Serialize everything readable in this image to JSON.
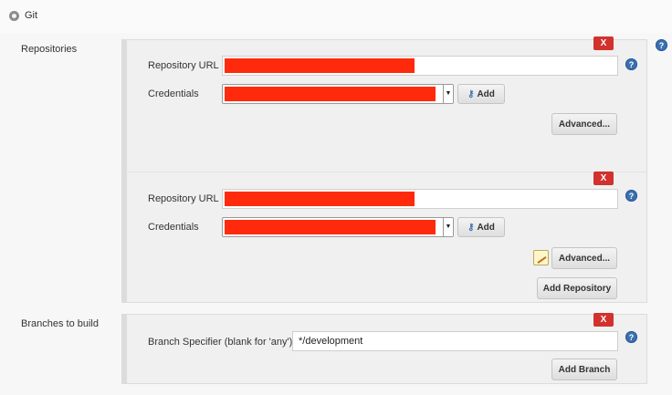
{
  "header": {
    "title": "Git"
  },
  "repositories": {
    "label": "Repositories",
    "items": [
      {
        "url_label": "Repository URL",
        "url_value": "",
        "credentials_label": "Credentials",
        "credentials_value": "",
        "add_label": "Add",
        "advanced_label": "Advanced...",
        "delete_label": "X"
      },
      {
        "url_label": "Repository URL",
        "url_value": "",
        "credentials_label": "Credentials",
        "credentials_value": "",
        "add_label": "Add",
        "advanced_label": "Advanced...",
        "delete_label": "X"
      }
    ],
    "add_repository_label": "Add Repository"
  },
  "branches": {
    "label": "Branches to build",
    "specifier_label": "Branch Specifier (blank for 'any')",
    "specifier_value": "*/development",
    "delete_label": "X",
    "add_branch_label": "Add Branch"
  },
  "help": {
    "glyph": "?"
  },
  "colors": {
    "redaction": "#ff2a0c",
    "delete": "#d2322d",
    "help": "#3a6fb0"
  }
}
